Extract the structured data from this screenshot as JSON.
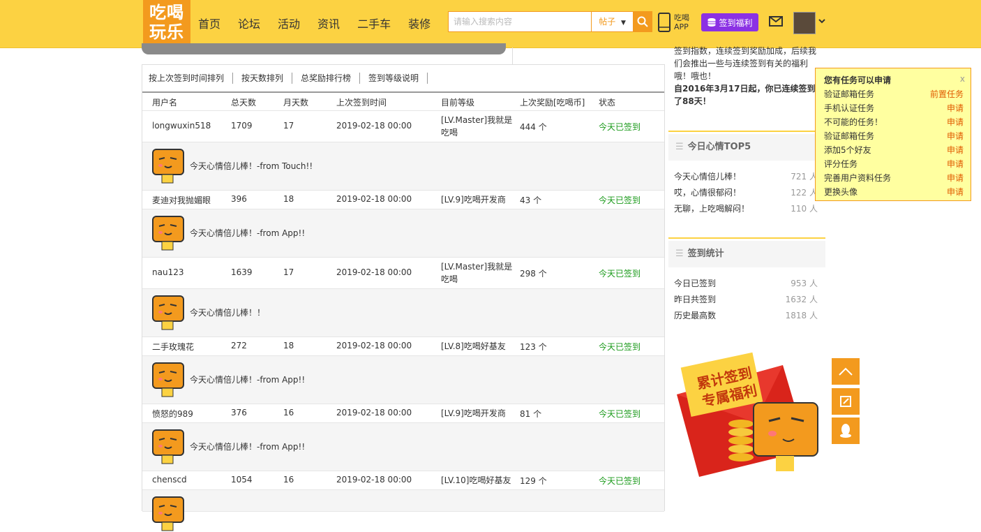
{
  "header": {
    "logo_line1": "吃喝",
    "logo_line2": "玩乐",
    "nav": [
      "首页",
      "论坛",
      "活动",
      "资讯",
      "二手车",
      "装修"
    ],
    "search_placeholder": "请输入搜索内容",
    "search_scope": "帖子",
    "app_line1": "吃喝",
    "app_line2": "APP",
    "sign_welfare": "签到福利",
    "brand_color": "#fcd242",
    "accent_color": "#f39a1e"
  },
  "tabs": [
    "按上次签到时间排列",
    "按天数排列",
    "总奖励排行榜",
    "签到等级说明"
  ],
  "columns": [
    "用户名",
    "总天数",
    "月天数",
    "上次签到时间",
    "目前等级",
    "上次奖励[吃喝币]",
    "状态"
  ],
  "rows": [
    {
      "user": "longwuxin518",
      "total": "1709",
      "month": "17",
      "time": "2019-02-18 00:00",
      "level": "[LV.Master]我就是吃喝",
      "reward": "444 个",
      "status": "今天已签到",
      "mood": "今天心情倍儿棒！-from Touch!!"
    },
    {
      "user": "麦迪对我抛媚眼",
      "total": "396",
      "month": "18",
      "time": "2019-02-18 00:00",
      "level": "[LV.9]吃喝开发商",
      "reward": "43 个",
      "status": "今天已签到",
      "mood": "今天心情倍儿棒！-from App!!"
    },
    {
      "user": "nau123",
      "total": "1639",
      "month": "17",
      "time": "2019-02-18 00:00",
      "level": "[LV.Master]我就是吃喝",
      "reward": "298 个",
      "status": "今天已签到",
      "mood": "今天心情倍儿棒！！"
    },
    {
      "user": "二手玫瑰花",
      "total": "272",
      "month": "18",
      "time": "2019-02-18 00:00",
      "level": "[LV.8]吃喝好基友",
      "reward": "123 个",
      "status": "今天已签到",
      "mood": "今天心情倍儿棒！-from App!!"
    },
    {
      "user": "愤怒的989",
      "total": "376",
      "month": "16",
      "time": "2019-02-18 00:00",
      "level": "[LV.9]吃喝开发商",
      "reward": "81 个",
      "status": "今天已签到",
      "mood": "今天心情倍儿棒！-from App!!"
    },
    {
      "user": "chenscd",
      "total": "1054",
      "month": "16",
      "time": "2019-02-18 00:00",
      "level": "[LV.10]吃喝好基友",
      "reward": "129 个",
      "status": "今天已签到",
      "mood": ""
    }
  ],
  "side_text": {
    "line1": "签到指数，连续签到奖励加成，后续我们会推出一些与连续签到有关的福利哦！哦也！",
    "line2": "自2016年3月17日起，你已连续签到了88天！"
  },
  "mood_top5": {
    "title": "今日心情TOP5",
    "items": [
      {
        "label": "今天心情倍儿棒！",
        "value": "721 人"
      },
      {
        "label": "哎，心情很郁闷！",
        "value": "122 人"
      },
      {
        "label": "无聊，上吃喝解闷！",
        "value": "110 人"
      }
    ]
  },
  "sign_stats": {
    "title": "签到统计",
    "items": [
      {
        "label": "今日已签到",
        "value": "953 人"
      },
      {
        "label": "昨日共签到",
        "value": "1632 人"
      },
      {
        "label": "历史最高数",
        "value": "1818 人"
      }
    ]
  },
  "promo": {
    "line1": "累计签到",
    "line2": "专属福利"
  },
  "tasks": {
    "title": "您有任务可以申请",
    "close": "x",
    "items": [
      {
        "name": "验证邮箱任务",
        "action": "前置任务"
      },
      {
        "name": "手机认证任务",
        "action": "申请"
      },
      {
        "name": "不可能的任务！",
        "action": "申请"
      },
      {
        "name": "验证邮箱任务",
        "action": "申请"
      },
      {
        "name": "添加5个好友",
        "action": "申请"
      },
      {
        "name": "评分任务",
        "action": "申请"
      },
      {
        "name": "完善用户资料任务",
        "action": "申请"
      },
      {
        "name": "更换头像",
        "action": "申请"
      }
    ]
  }
}
